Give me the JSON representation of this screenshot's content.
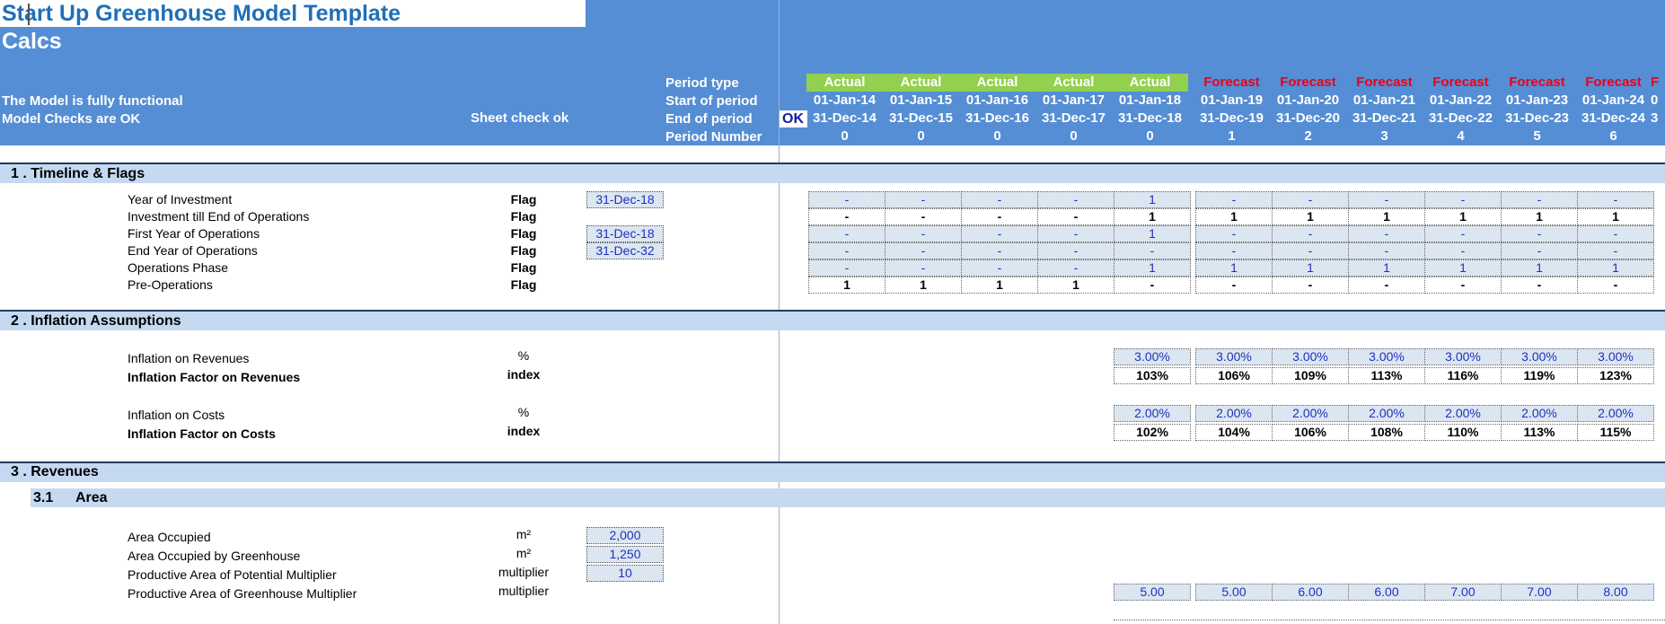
{
  "header": {
    "title": "Start Up Greenhouse Model Template",
    "sheet_name": "Calcs",
    "status_functional": "The Model is fully functional",
    "status_checks": "Model Checks are OK",
    "sheet_check": "Sheet check ok",
    "ok_badge": "OK",
    "row_labels": {
      "period_type": "Period type",
      "start": "Start of period",
      "end": "End of period",
      "number": "Period Number"
    }
  },
  "periods": [
    {
      "type": "Actual",
      "start": "01-Jan-14",
      "end": "31-Dec-14",
      "num": "0"
    },
    {
      "type": "Actual",
      "start": "01-Jan-15",
      "end": "31-Dec-15",
      "num": "0"
    },
    {
      "type": "Actual",
      "start": "01-Jan-16",
      "end": "31-Dec-16",
      "num": "0"
    },
    {
      "type": "Actual",
      "start": "01-Jan-17",
      "end": "31-Dec-17",
      "num": "0"
    },
    {
      "type": "Actual",
      "start": "01-Jan-18",
      "end": "31-Dec-18",
      "num": "0"
    },
    {
      "type": "Forecast",
      "start": "01-Jan-19",
      "end": "31-Dec-19",
      "num": "1"
    },
    {
      "type": "Forecast",
      "start": "01-Jan-20",
      "end": "31-Dec-20",
      "num": "2"
    },
    {
      "type": "Forecast",
      "start": "01-Jan-21",
      "end": "31-Dec-21",
      "num": "3"
    },
    {
      "type": "Forecast",
      "start": "01-Jan-22",
      "end": "31-Dec-22",
      "num": "4"
    },
    {
      "type": "Forecast",
      "start": "01-Jan-23",
      "end": "31-Dec-23",
      "num": "5"
    },
    {
      "type": "Forecast",
      "start": "01-Jan-24",
      "end": "31-Dec-24",
      "num": "6"
    },
    {
      "type": "F",
      "start": "0",
      "end": "3",
      "num": ""
    }
  ],
  "sections": {
    "s1": "1 .  Timeline & Flags",
    "s2": "2 .  Inflation Assumptions",
    "s3": "3 .  Revenues",
    "s31_num": "3.1",
    "s31": "Area"
  },
  "flags": [
    {
      "label": "Year of Investment",
      "unit": "Flag",
      "input": "31-Dec-18",
      "style": "blue",
      "values": [
        "-",
        "-",
        "-",
        "-",
        "1",
        "-",
        "-",
        "-",
        "-",
        "-",
        "-"
      ]
    },
    {
      "label": "Investment till End of Operations",
      "unit": "Flag",
      "input": "",
      "style": "wht",
      "values": [
        "-",
        "-",
        "-",
        "-",
        "1",
        "1",
        "1",
        "1",
        "1",
        "1",
        "1"
      ]
    },
    {
      "label": "First Year of Operations",
      "unit": "Flag",
      "input": "31-Dec-18",
      "style": "blue",
      "values": [
        "-",
        "-",
        "-",
        "-",
        "1",
        "-",
        "-",
        "-",
        "-",
        "-",
        "-"
      ]
    },
    {
      "label": "End Year of Operations",
      "unit": "Flag",
      "input": "31-Dec-32",
      "style": "blue",
      "values": [
        "-",
        "-",
        "-",
        "-",
        "-",
        "-",
        "-",
        "-",
        "-",
        "-",
        "-"
      ]
    },
    {
      "label": "Operations Phase",
      "unit": "Flag",
      "input": "",
      "style": "blue",
      "values": [
        "-",
        "-",
        "-",
        "-",
        "1",
        "1",
        "1",
        "1",
        "1",
        "1",
        "1"
      ]
    },
    {
      "label": "Pre-Operations",
      "unit": "Flag",
      "input": "",
      "style": "wht",
      "values": [
        "1",
        "1",
        "1",
        "1",
        "-",
        "-",
        "-",
        "-",
        "-",
        "-",
        "-"
      ]
    }
  ],
  "inflation": [
    {
      "label": "Inflation on Revenues",
      "unit": "%",
      "bold": false,
      "style": "blue",
      "values": [
        "3.00%",
        "3.00%",
        "3.00%",
        "3.00%",
        "3.00%",
        "3.00%",
        "3.00%"
      ]
    },
    {
      "label": "Inflation Factor on Revenues",
      "unit": "index",
      "bold": true,
      "style": "wht",
      "values": [
        "103%",
        "106%",
        "109%",
        "113%",
        "116%",
        "119%",
        "123%"
      ]
    },
    {
      "label": "Inflation on Costs",
      "unit": "%",
      "bold": false,
      "style": "blue",
      "values": [
        "2.00%",
        "2.00%",
        "2.00%",
        "2.00%",
        "2.00%",
        "2.00%",
        "2.00%"
      ]
    },
    {
      "label": "Inflation Factor on Costs",
      "unit": "index",
      "bold": true,
      "style": "wht",
      "values": [
        "102%",
        "104%",
        "106%",
        "108%",
        "110%",
        "113%",
        "115%"
      ]
    }
  ],
  "area": [
    {
      "label": "Area Occupied",
      "unit": "m²",
      "input": "2,000",
      "values": []
    },
    {
      "label": "Area Occupied by Greenhouse",
      "unit": "m²",
      "input": "1,250",
      "values": []
    },
    {
      "label": "Productive Area of Potential Multiplier",
      "unit": "multiplier",
      "input": "10",
      "values": []
    },
    {
      "label": "Productive Area of Greenhouse Multiplier",
      "unit": "multiplier",
      "input": "",
      "values": [
        "5.00",
        "5.00",
        "6.00",
        "6.00",
        "7.00",
        "7.00",
        "8.00"
      ]
    }
  ],
  "colors": {
    "header_blue": "#558ed5",
    "actual_green": "#92d050",
    "forecast_red": "#e8001c",
    "section_band": "#c5d9f1",
    "input_fill": "#dce6f1",
    "input_text": "#2030c0"
  }
}
